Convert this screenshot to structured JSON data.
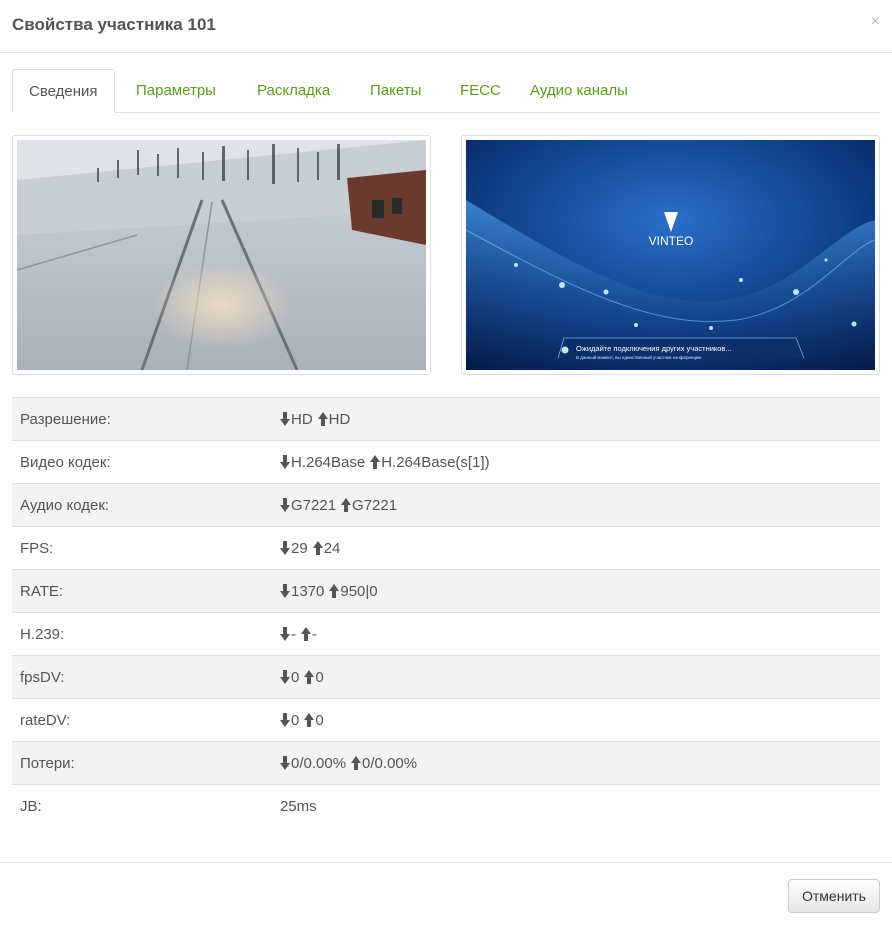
{
  "modal": {
    "title": "Свойства участника 101",
    "close_icon": "×"
  },
  "tabs": [
    {
      "label": "Сведения",
      "active": true
    },
    {
      "label": "Параметры"
    },
    {
      "label": "Раскладка"
    },
    {
      "label": "Пакеты"
    },
    {
      "label": "FECC"
    },
    {
      "label": "Аудио каналы"
    }
  ],
  "videos": {
    "remote": {
      "icon": "video-frame-snowy-road"
    },
    "local": {
      "brand": "VINTEO",
      "status": "Ожидайте подключения других участников...",
      "note": "В данный момент, вы единственный участник конференции"
    }
  },
  "properties": [
    {
      "label": "Разрешение:",
      "down": "HD",
      "up": "HD"
    },
    {
      "label": "Видео кодек:",
      "down": "H.264Base",
      "up": "H.264Base(s[1])"
    },
    {
      "label": "Аудио кодек:",
      "down": "G7221",
      "up": "G7221"
    },
    {
      "label": "FPS:",
      "down": "29",
      "up": "24"
    },
    {
      "label": "RATE:",
      "down": "1370",
      "up": "950|0"
    },
    {
      "label": "H.239:",
      "down": "-",
      "up": "-"
    },
    {
      "label": "fpsDV:",
      "down": "0",
      "up": "0"
    },
    {
      "label": "rateDV:",
      "down": "0",
      "up": "0"
    },
    {
      "label": "Потери:",
      "down": "0/0.00%",
      "up": "0/0.00%"
    },
    {
      "label": "JB:",
      "value": "25ms"
    }
  ],
  "footer": {
    "cancel_label": "Отменить"
  },
  "colors": {
    "tab_link": "#5a9d1a",
    "stripe": "#f3f3f3"
  }
}
